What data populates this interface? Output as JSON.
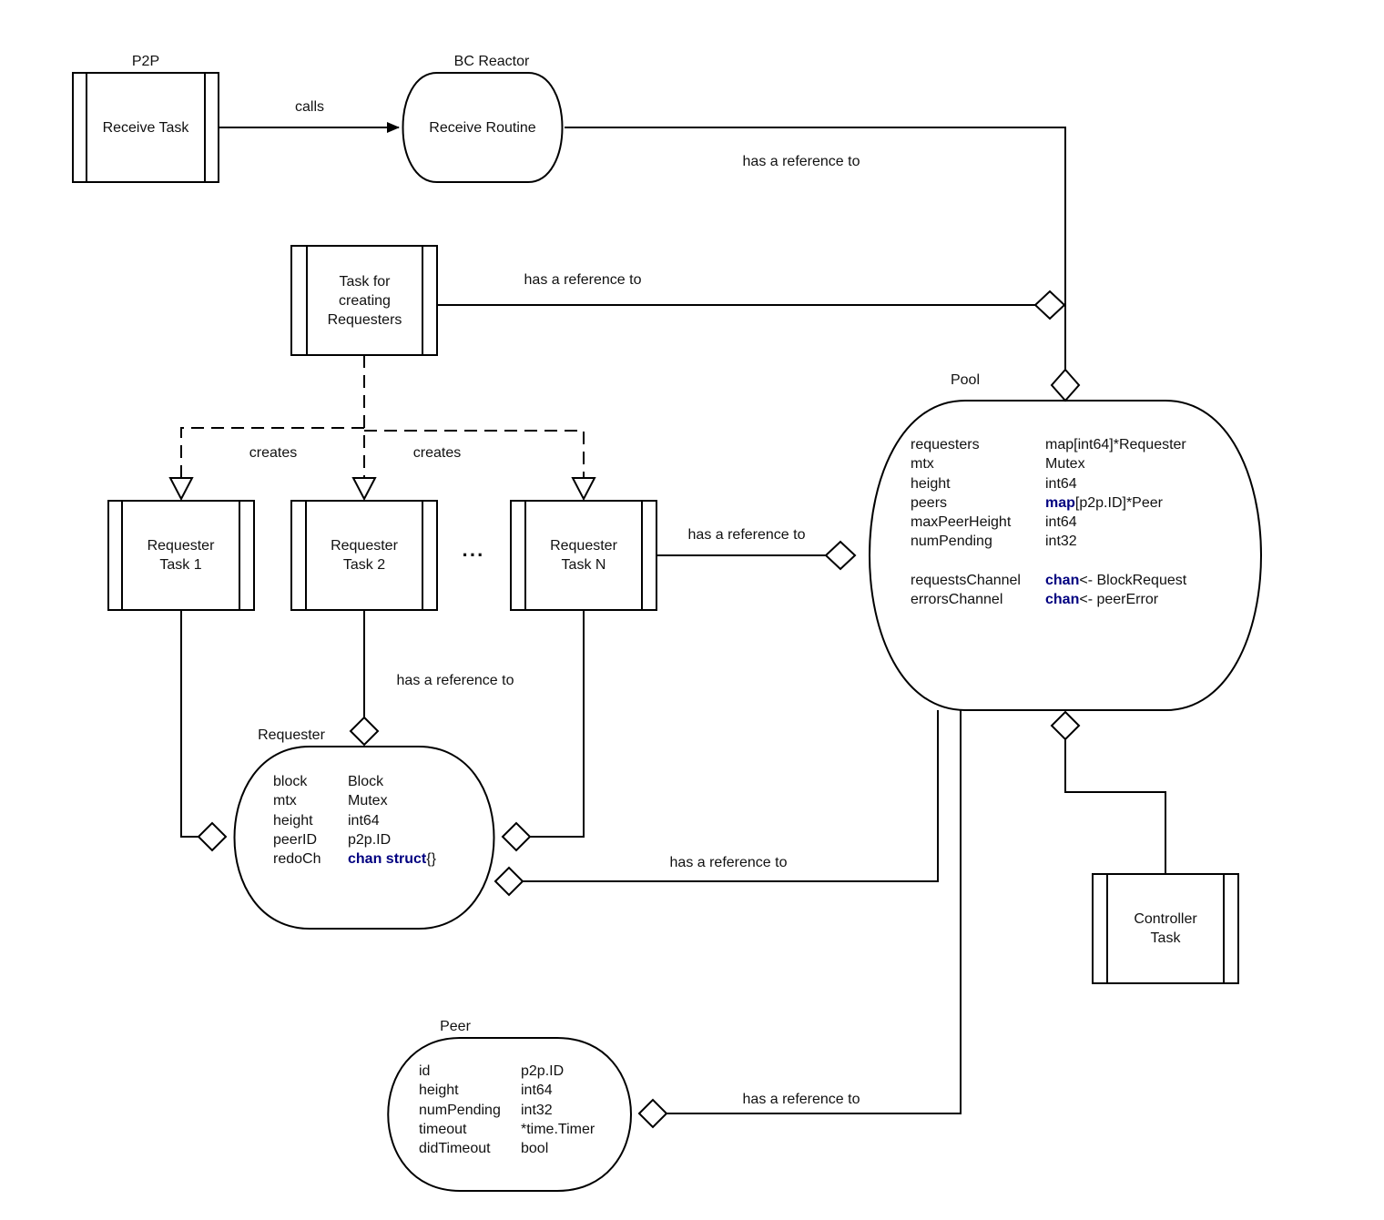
{
  "diagram": {
    "title_labels": {
      "p2p": "P2P",
      "bc_reactor": "BC Reactor",
      "pool": "Pool",
      "requester": "Requester",
      "peer": "Peer"
    },
    "nodes": {
      "receive_task": "Receive Task",
      "receive_routine": "Receive Routine",
      "task_creating_requesters": [
        "Task for",
        "creating",
        "Requesters"
      ],
      "requester_task_1": [
        "Requester",
        "Task 1"
      ],
      "requester_task_2": [
        "Requester",
        "Task 2"
      ],
      "requester_task_n": [
        "Requester",
        "Task N"
      ],
      "ellipsis": "···",
      "controller_task": [
        "Controller",
        "Task"
      ]
    },
    "edges": {
      "calls": "calls",
      "creates_1": "creates",
      "creates_2": "creates",
      "ref_routine_pool": "has a reference to",
      "ref_creator_pool": "has a reference to",
      "ref_taskn_pool": "has a reference to",
      "ref_task2_requester": "has a reference to",
      "ref_pool_requester": "has a reference to",
      "ref_pool_peer": "has a reference to"
    },
    "pool_fields": [
      {
        "name": "requesters",
        "type_kw": "",
        "type": "map[int64]*Requester"
      },
      {
        "name": "mtx",
        "type_kw": "",
        "type": "Mutex"
      },
      {
        "name": "height",
        "type_kw": "",
        "type": "int64"
      },
      {
        "name": "peers",
        "type_kw": "map",
        "type": "[p2p.ID]*Peer"
      },
      {
        "name": "maxPeerHeight",
        "type_kw": "",
        "type": "int64"
      },
      {
        "name": "numPending",
        "type_kw": "",
        "type": "int32"
      },
      {
        "name": "",
        "type_kw": "",
        "type": ""
      },
      {
        "name": "requestsChannel",
        "type_kw": "chan",
        "type": "<- BlockRequest"
      },
      {
        "name": "errorsChannel",
        "type_kw": "chan",
        "type": "<- peerError"
      }
    ],
    "requester_fields": [
      {
        "name": "block",
        "type_kw": "",
        "type": "Block"
      },
      {
        "name": "mtx",
        "type_kw": "",
        "type": "Mutex"
      },
      {
        "name": "height",
        "type_kw": "",
        "type": "int64"
      },
      {
        "name": "peerID",
        "type_kw": "",
        "type": "p2p.ID"
      },
      {
        "name": "redoCh",
        "type_kw": "chan struct",
        "type": "{}"
      }
    ],
    "peer_fields": [
      {
        "name": "id",
        "type_kw": "",
        "type": "p2p.ID"
      },
      {
        "name": "height",
        "type_kw": "",
        "type": "int64"
      },
      {
        "name": "numPending",
        "type_kw": "",
        "type": "int32"
      },
      {
        "name": "timeout",
        "type_kw": "",
        "type": "*time.Timer"
      },
      {
        "name": "didTimeout",
        "type_kw": "",
        "type": "bool"
      }
    ],
    "colors": {
      "keyword": "#000080",
      "line": "#000000",
      "background": "#ffffff"
    }
  }
}
